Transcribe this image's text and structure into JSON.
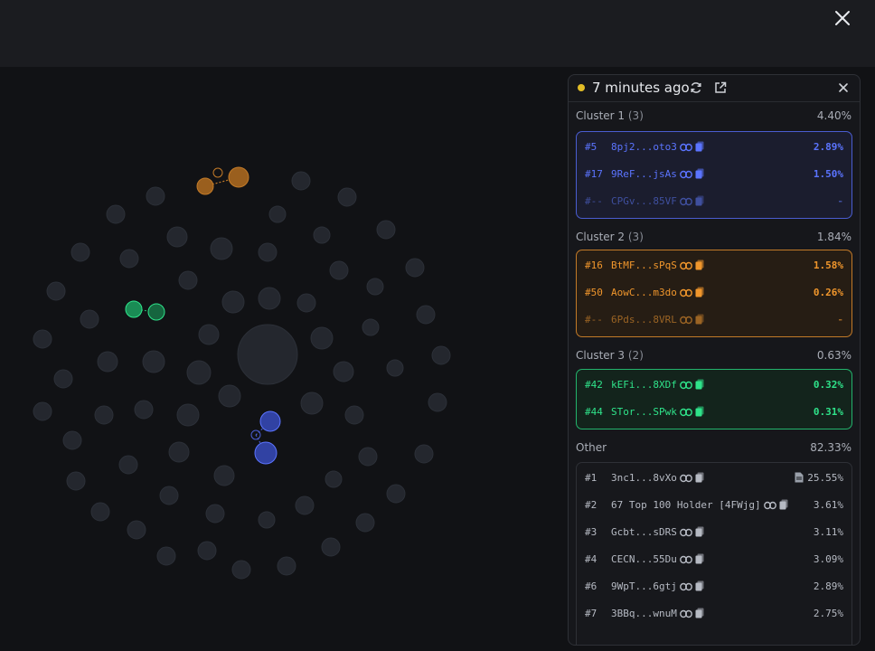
{
  "header": {
    "close_icon": "close-icon"
  },
  "panel": {
    "status_color": "#e2bd26",
    "updated_text": "7 minutes ago",
    "refresh_icon": "refresh-icon",
    "open_external_icon": "external-link-icon",
    "close_icon": "close-icon"
  },
  "clusters": [
    {
      "label": "Cluster 1",
      "count": "(3)",
      "percent": "4.40%",
      "color": "#5b74ff",
      "rows": [
        {
          "rank": "#5",
          "address": "8pj2...oto3",
          "percent": "2.89%"
        },
        {
          "rank": "#17",
          "address": "9ReF...jsAs",
          "percent": "1.50%"
        },
        {
          "rank": "#--",
          "address": "CPGv...85VF",
          "percent": "-"
        }
      ]
    },
    {
      "label": "Cluster 2",
      "count": "(3)",
      "percent": "1.84%",
      "color": "#f0962c",
      "rows": [
        {
          "rank": "#16",
          "address": "BtMF...sPqS",
          "percent": "1.58%"
        },
        {
          "rank": "#50",
          "address": "AowC...m3do",
          "percent": "0.26%"
        },
        {
          "rank": "#--",
          "address": "6Pds...8VRL",
          "percent": "-"
        }
      ]
    },
    {
      "label": "Cluster 3",
      "count": "(2)",
      "percent": "0.63%",
      "color": "#2fe38a",
      "rows": [
        {
          "rank": "#42",
          "address": "kEFi...8XDf",
          "percent": "0.32%"
        },
        {
          "rank": "#44",
          "address": "STor...SPwk",
          "percent": "0.31%"
        }
      ]
    }
  ],
  "other": {
    "label": "Other",
    "percent": "82.33%",
    "rows": [
      {
        "rank": "#1",
        "address": "3nc1...8vXo",
        "percent": "25.55%",
        "badge": "document-icon"
      },
      {
        "rank": "#2",
        "address": "67 Top 100 Holder [4FWjg]",
        "percent": "3.61%"
      },
      {
        "rank": "#3",
        "address": "Gcbt...sDRS",
        "percent": "3.11%"
      },
      {
        "rank": "#4",
        "address": "CECN...55Du",
        "percent": "3.09%"
      },
      {
        "rank": "#6",
        "address": "9WpT...6gtj",
        "percent": "2.89%"
      },
      {
        "rank": "#7",
        "address": "3BBq...wnuM",
        "percent": "2.75%"
      }
    ]
  },
  "row_icons": {
    "link": "link-icon",
    "copy": "copy-icon"
  }
}
